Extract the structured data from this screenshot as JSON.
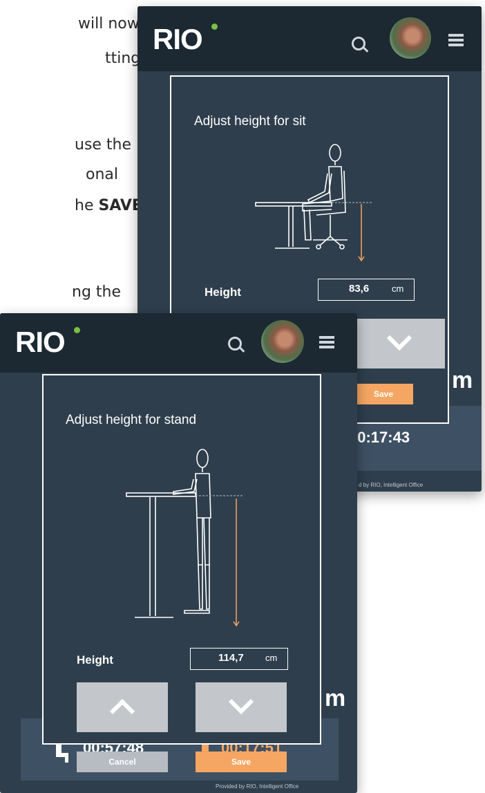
{
  "doc": {
    "line1": "will now",
    "line2": "tting",
    "line3": "use the",
    "line4": "onal",
    "line5_prefix": "he ",
    "line5_bold": "SAVE",
    "line6": "ng the"
  },
  "back_screen": {
    "logo": "RIO",
    "dialog_title": "Adjust height for sit",
    "height_label": "Height",
    "height_value": "83,6",
    "height_unit": "cm",
    "save_label": "Save",
    "partial_unit": "m",
    "timer": "00:17:43",
    "footer_note": "d by RIO, Intelligent Office"
  },
  "front_screen": {
    "logo": "RIO",
    "dialog_title": "Adjust height for stand",
    "height_label": "Height",
    "height_value": "114,7",
    "height_unit": "cm",
    "cancel_label": "Cancel",
    "save_label": "Save",
    "partial_unit": "m",
    "sit_timer": "00:57:48",
    "stand_timer": "00:17:51",
    "footer_note": "Provided by RIO, Intelligent Office"
  },
  "colors": {
    "appbar": "#1c2832",
    "background": "#2e3e4c",
    "save": "#f5a663",
    "cancel": "#b7bcc2",
    "arrow_button": "#c3c7cc",
    "logo_dot": "#7bc043"
  },
  "icons": [
    "search-icon",
    "avatar",
    "menu-icon",
    "chevron-up-icon",
    "chevron-down-icon",
    "sitting-person-icon",
    "standing-person-icon"
  ]
}
